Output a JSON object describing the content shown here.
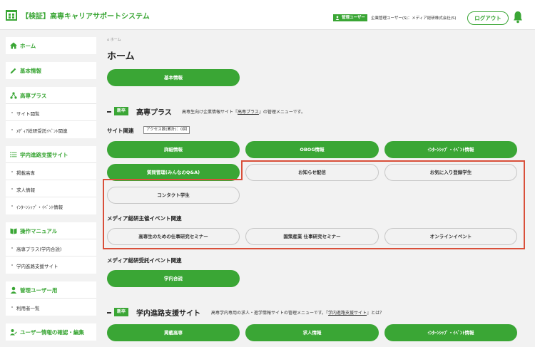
{
  "header": {
    "title": "【検証】高専キャリアサポートシステム",
    "role_badge": "管理ユーザー",
    "user_text": "企業管理ユーザー(S)：メディア総研株式会社(S)",
    "logout_label": "ログアウト"
  },
  "sidebar": {
    "home": "ホーム",
    "basic_info": "基本情報",
    "kosen_plus": "高専プラス",
    "kosen_plus_items": [
      "サイト閲覧",
      "ﾒﾃﾞｨｱ総研受託ｲﾍﾞﾝﾄ関連"
    ],
    "course_site": "学内進路支援サイト",
    "course_site_items": [
      "掲載高専",
      "求人情報",
      "ｲﾝﾀｰﾝｼｯﾌﾟ・ｲﾍﾞﾝﾄ情報"
    ],
    "manual": "操作マニュアル",
    "manual_items": [
      "高専プラス(学内合説)",
      "学内進路支援サイト"
    ],
    "admin_users": "管理ユーザー用",
    "admin_items": [
      "利用者一覧"
    ],
    "user_info": "ユーザー情報の確認・編集"
  },
  "main": {
    "breadcrumb": "ホーム",
    "page_title": "ホーム",
    "basic_info_button": "基本情報",
    "kosen_plus_section": {
      "badge": "新卒",
      "title": "高専プラス",
      "desc_prefix": "高専生向け企業情報サイト『",
      "desc_link": "高専プラス",
      "desc_suffix": "』の管理メニューです。",
      "site_label": "サイト関連",
      "access_count": "アクセス数(累計)：0回",
      "buttons_row1": [
        "詳細情報",
        "OBOG情報",
        "ｲﾝﾀｰﾝｼｯﾌﾟ・ｲﾍﾞﾝﾄ情報"
      ],
      "qa_button": "質問管理(みんなのQ&A)",
      "notice_button": "お知らせ配信",
      "favorite_button": "お気に入り登録学生",
      "contact_button": "コンタクト学生",
      "media_event_label": "メディア総研主催イベント関連",
      "media_event_buttons": [
        "高専生のための仕事研究セミナー",
        "国策産業 仕事研究セミナー",
        "オンラインイベント"
      ],
      "contract_event_label": "メディア総研受託イベント関連",
      "campus_fair_button": "学内合説"
    },
    "course_section": {
      "badge": "新卒",
      "title": "学内進路支援サイト",
      "desc_prefix": "高専学内専用の求人・進学情報サイトの管理メニューです。『",
      "desc_link": "学内進路支援サイト",
      "desc_suffix": "』とは？",
      "buttons": [
        "掲載高専",
        "求人情報",
        "ｲﾝﾀｰﾝｼｯﾌﾟ・ｲﾍﾞﾝﾄ情報"
      ]
    }
  },
  "colors": {
    "accent": "#3aa635",
    "highlight": "#d94f3a",
    "background": "#f2f2f2"
  }
}
